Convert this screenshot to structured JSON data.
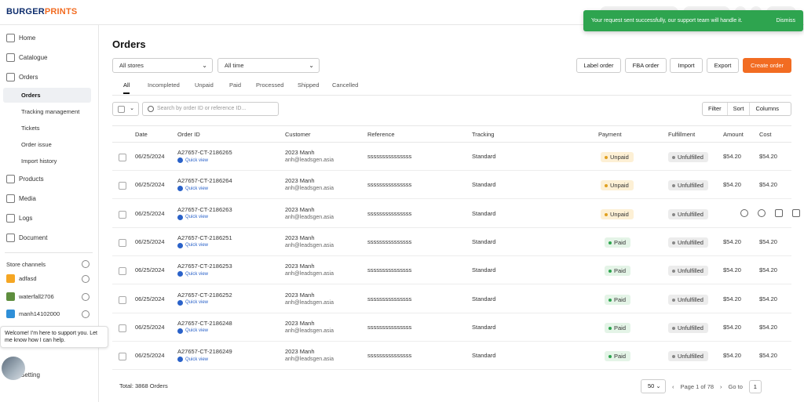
{
  "app": {
    "logo_a": "BURGER",
    "logo_b": "PRINTS"
  },
  "toast": {
    "message": "Your request sent successfully, our support team will handle it.",
    "dismiss": "Dismiss",
    "color": "#2ea44f"
  },
  "sidebar": {
    "nav": [
      {
        "label": "Home",
        "icon": "home-icon"
      },
      {
        "label": "Catalogue",
        "icon": "catalogue-icon"
      },
      {
        "label": "Orders",
        "icon": "orders-icon"
      }
    ],
    "orders_sub": [
      "Orders",
      "Tracking management",
      "Tickets",
      "Order issue",
      "Import history"
    ],
    "nav2": [
      {
        "label": "Products",
        "icon": "products-icon"
      },
      {
        "label": "Media",
        "icon": "media-icon"
      },
      {
        "label": "Logs",
        "icon": "logs-icon"
      },
      {
        "label": "Document",
        "icon": "document-icon"
      }
    ],
    "store_channels_title": "Store channels",
    "stores": [
      {
        "name": "adfasd",
        "icon": "store-icon",
        "color": "#f5a623"
      },
      {
        "name": "waterfall2706",
        "icon": "shopify-icon",
        "color": "#5e8e3e"
      },
      {
        "name": "manh14102000",
        "icon": "woo-icon",
        "color": "#2f8fd8"
      }
    ],
    "setting": "Setting",
    "chat": "Welcome! I'm here to support you. Let me know how I can help."
  },
  "main": {
    "title": "Orders",
    "store_filter": "All stores",
    "time_filter": "All time",
    "buttons": {
      "label_order": "Label order",
      "fba_order": "FBA order",
      "import": "Import",
      "export": "Export",
      "create": "Create order"
    },
    "accent": "#f26c22",
    "tabs": [
      "All",
      "Incompleted",
      "Unpaid",
      "Paid",
      "Processed",
      "Shipped",
      "Cancelled"
    ],
    "search_placeholder": "Search by order ID or reference ID...",
    "tools": [
      "Filter",
      "Sort",
      "Columns"
    ],
    "columns": [
      "Date",
      "Order ID",
      "Customer",
      "Reference",
      "Tracking",
      "Payment",
      "Fulfillment",
      "Amount",
      "Cost"
    ],
    "quick_view": "Quick view",
    "rows": [
      {
        "date": "06/25/2024",
        "id": "A27657-CT-2186265",
        "name": "2023 Manh",
        "email": "anh@leadsgen.asia",
        "ref": "sssssssssssssss",
        "tracking": "Standard",
        "payment": "Unpaid",
        "fulfillment": "Unfulfilled",
        "amount": "$54.20",
        "cost": "$54.20"
      },
      {
        "date": "06/25/2024",
        "id": "A27657-CT-2186264",
        "name": "2023 Manh",
        "email": "anh@leadsgen.asia",
        "ref": "sssssssssssssss",
        "tracking": "Standard",
        "payment": "Unpaid",
        "fulfillment": "Unfulfilled",
        "amount": "$54.20",
        "cost": "$54.20"
      },
      {
        "date": "06/25/2024",
        "id": "A27657-CT-2186263",
        "name": "2023 Manh",
        "email": "anh@leadsgen.asia",
        "ref": "sssssssssssssss",
        "tracking": "Standard",
        "payment": "Unpaid",
        "fulfillment": "Unfulfilled",
        "amount": "",
        "cost": ""
      },
      {
        "date": "06/25/2024",
        "id": "A27657-CT-2186251",
        "name": "2023 Manh",
        "email": "anh@leadsgen.asia",
        "ref": "sssssssssssssss",
        "tracking": "Standard",
        "payment": "Paid",
        "fulfillment": "Unfulfilled",
        "amount": "$54.20",
        "cost": "$54.20"
      },
      {
        "date": "06/25/2024",
        "id": "A27657-CT-2186253",
        "name": "2023 Manh",
        "email": "anh@leadsgen.asia",
        "ref": "sssssssssssssss",
        "tracking": "Standard",
        "payment": "Paid",
        "fulfillment": "Unfulfilled",
        "amount": "$54.20",
        "cost": "$54.20"
      },
      {
        "date": "06/25/2024",
        "id": "A27657-CT-2186252",
        "name": "2023 Manh",
        "email": "anh@leadsgen.asia",
        "ref": "sssssssssssssss",
        "tracking": "Standard",
        "payment": "Paid",
        "fulfillment": "Unfulfilled",
        "amount": "$54.20",
        "cost": "$54.20"
      },
      {
        "date": "06/25/2024",
        "id": "A27657-CT-2186248",
        "name": "2023 Manh",
        "email": "anh@leadsgen.asia",
        "ref": "sssssssssssssss",
        "tracking": "Standard",
        "payment": "Paid",
        "fulfillment": "Unfulfilled",
        "amount": "$54.20",
        "cost": "$54.20"
      },
      {
        "date": "06/25/2024",
        "id": "A27657-CT-2186249",
        "name": "2023 Manh",
        "email": "anh@leadsgen.asia",
        "ref": "sssssssssssssss",
        "tracking": "Standard",
        "payment": "Paid",
        "fulfillment": "Unfulfilled",
        "amount": "$54.20",
        "cost": "$54.20"
      }
    ],
    "total": "Total: 3868 Orders",
    "page_size": "50",
    "page_info": "Page 1 of 78",
    "goto_label": "Go to",
    "goto_value": "1"
  }
}
